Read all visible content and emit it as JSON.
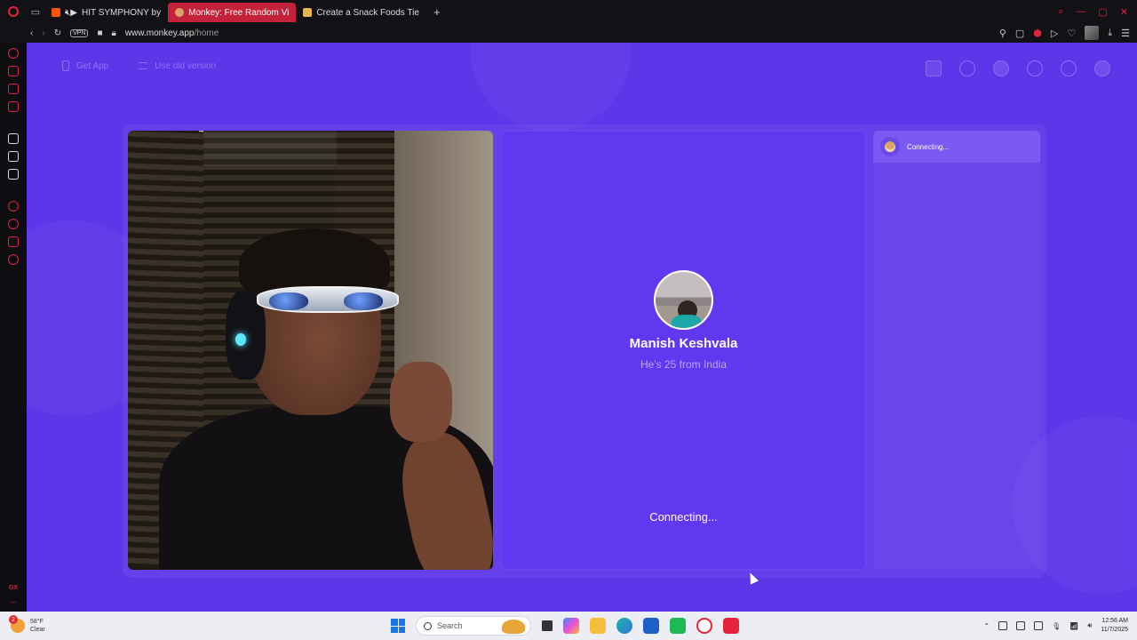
{
  "browser": {
    "tabs": [
      {
        "label": "HIT SYMPHONY by",
        "active": false
      },
      {
        "label": "Monkey: Free Random Vi",
        "active": true
      },
      {
        "label": "Create a Snack Foods Tie",
        "active": false
      }
    ],
    "new_tab": "+",
    "vpn": "VPN",
    "url_domain": "www.monkey.app",
    "url_path": "/home",
    "accent": "#c3223a"
  },
  "page": {
    "bg_color": "#5d36ea",
    "nav": {
      "get_app": "Get App",
      "use_old_version": "Use old version"
    },
    "match": {
      "name": "Manish Keshvala",
      "subtitle": "He's 25 from India",
      "status": "Connecting..."
    },
    "chat": {
      "status": "Connecting..."
    }
  },
  "taskbar": {
    "weather_temp": "58°F",
    "weather_desc": "Clear",
    "weather_badge": "2",
    "search_placeholder": "Search",
    "time": "12:56 AM",
    "date": "11/7/2025"
  }
}
